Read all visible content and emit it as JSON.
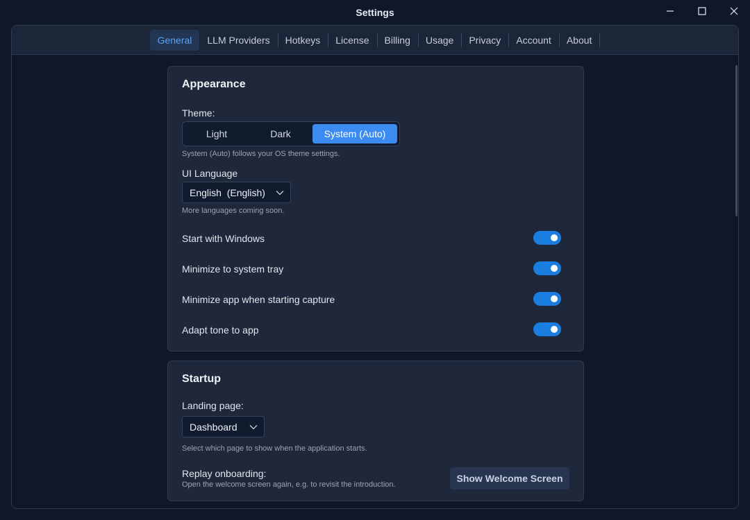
{
  "window": {
    "title": "Settings"
  },
  "tabs": [
    {
      "label": "General",
      "active": true
    },
    {
      "label": "LLM Providers"
    },
    {
      "label": "Hotkeys"
    },
    {
      "label": "License"
    },
    {
      "label": "Billing"
    },
    {
      "label": "Usage"
    },
    {
      "label": "Privacy"
    },
    {
      "label": "Account"
    },
    {
      "label": "About"
    }
  ],
  "appearance": {
    "heading": "Appearance",
    "theme_label": "Theme:",
    "theme_options": [
      "Light",
      "Dark",
      "System (Auto)"
    ],
    "theme_selected": "System (Auto)",
    "theme_hint": "System (Auto) follows your OS theme settings.",
    "language_label": "UI Language",
    "language_value": "English  (English)",
    "language_hint": "More languages coming soon.",
    "toggles": [
      {
        "label": "Start with Windows",
        "on": true
      },
      {
        "label": "Minimize to system tray",
        "on": true
      },
      {
        "label": "Minimize app when starting capture",
        "on": true
      },
      {
        "label": "Adapt tone to app",
        "on": true
      }
    ]
  },
  "startup": {
    "heading": "Startup",
    "landing_label": "Landing page:",
    "landing_value": "Dashboard",
    "landing_hint": "Select which page to show when the application starts.",
    "replay_label": "Replay onboarding:",
    "replay_hint": "Open the welcome screen again, e.g. to revisit the introduction.",
    "replay_button": "Show Welcome Screen"
  },
  "icons": {
    "minimize": "minimize-icon",
    "maximize": "maximize-icon",
    "close": "close-icon",
    "dropdown": "chevron-down-icon"
  },
  "colors": {
    "accent": "#3b8bf0",
    "toggle_on": "#1a7ee0",
    "background": "#0f1729",
    "card": "#1e283a"
  }
}
